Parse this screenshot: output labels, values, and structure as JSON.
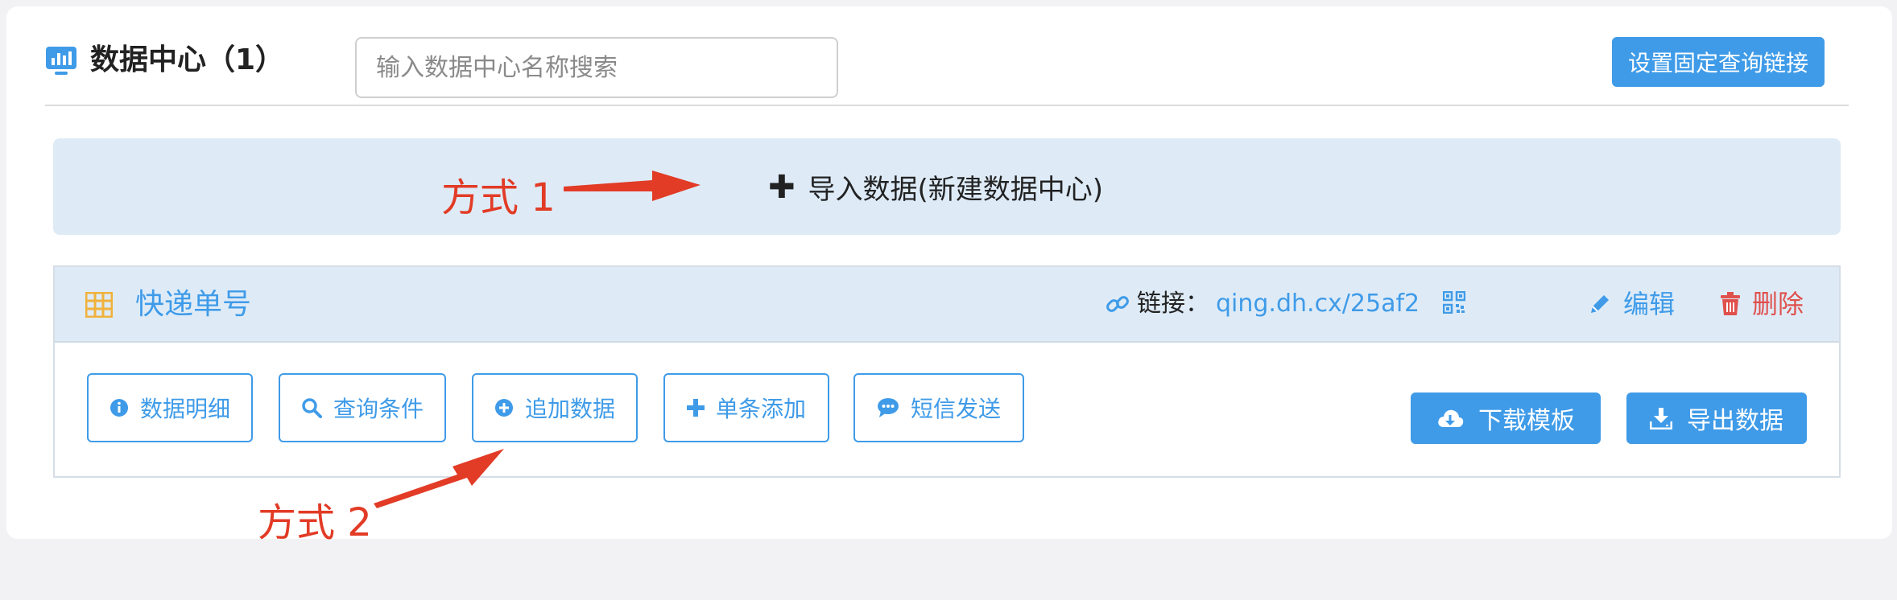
{
  "header": {
    "title": "数据中心（1）",
    "search_placeholder": "输入数据中心名称搜索",
    "fixed_link_button": "设置固定查询链接"
  },
  "import": {
    "label": "导入数据(新建数据中心)"
  },
  "annotations": {
    "method1": "方式 1",
    "method2": "方式 2"
  },
  "panel": {
    "title": "快递单号",
    "link_label": "链接：",
    "link_url": "qing.dh.cx/25af2",
    "edit_label": "编辑",
    "delete_label": "删除",
    "actions": [
      "数据明细",
      "查询条件",
      "追加数据",
      "单条添加",
      "短信发送"
    ],
    "download_template": "下载模板",
    "export_data": "导出数据"
  },
  "colors": {
    "accent": "#3f9be8",
    "danger": "#e0504c",
    "annotation": "#e23b26",
    "bar_bg": "#deebf7",
    "table_icon": "#f0b23c"
  }
}
